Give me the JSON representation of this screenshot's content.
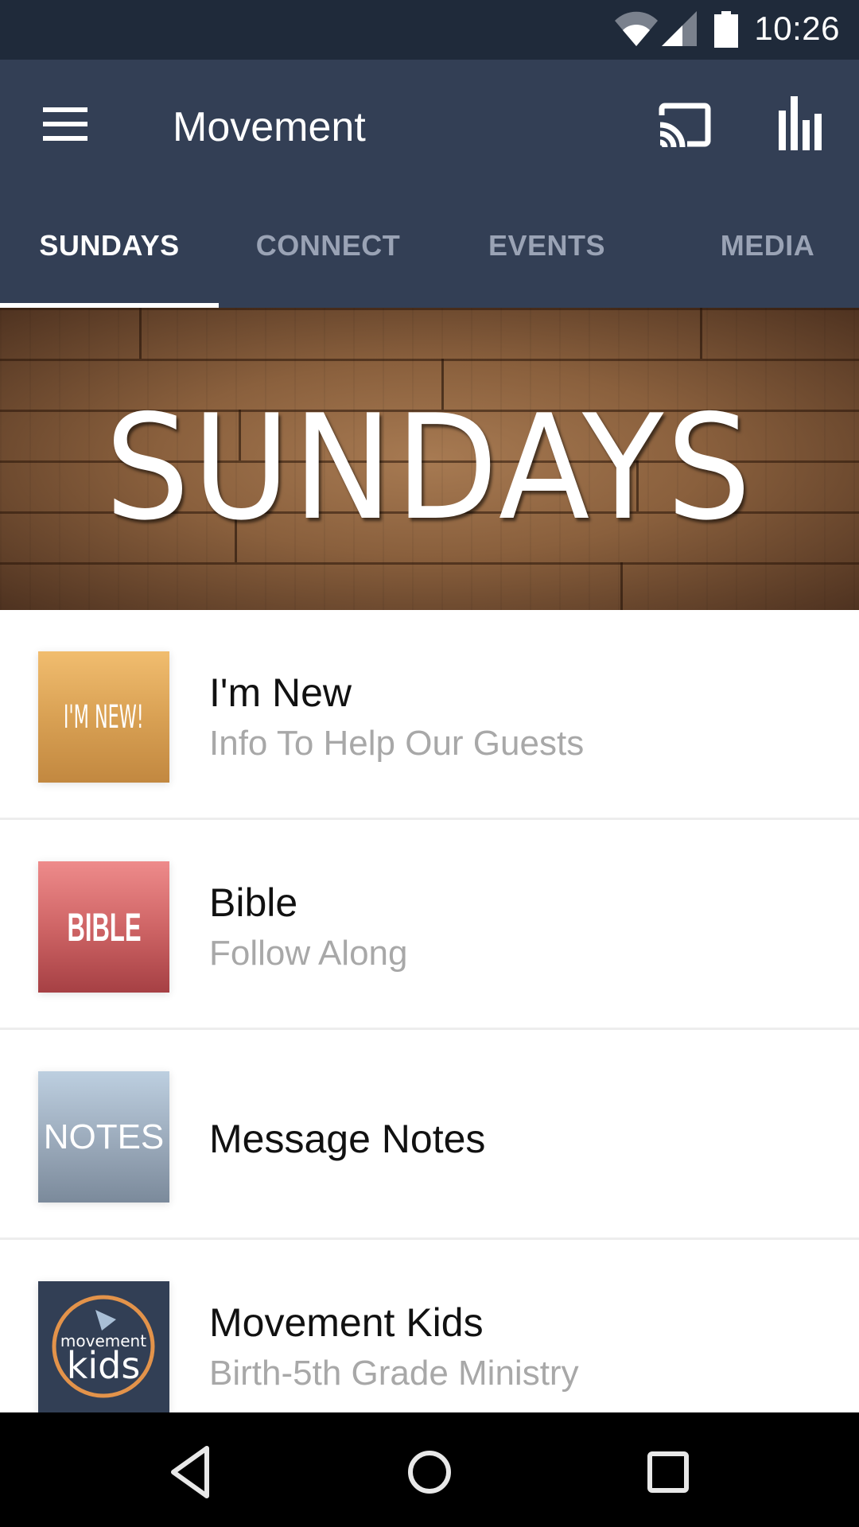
{
  "status_bar": {
    "time": "10:26",
    "icons": [
      "wifi-icon",
      "cellular-signal-icon",
      "battery-icon"
    ]
  },
  "app_bar": {
    "title": "Movement",
    "menu_icon": "hamburger-menu-icon",
    "actions": [
      {
        "name": "cast",
        "icon": "cast-icon"
      },
      {
        "name": "stats",
        "icon": "bar-chart-icon"
      }
    ],
    "background": "#333f55"
  },
  "tabs": [
    {
      "label": "SUNDAYS",
      "active": true
    },
    {
      "label": "CONNECT",
      "active": false
    },
    {
      "label": "EVENTS",
      "active": false
    },
    {
      "label": "MEDIA",
      "active": false
    }
  ],
  "banner": {
    "text": "SUNDAYS"
  },
  "list": [
    {
      "thumb_text": "I'M NEW!",
      "title": "I'm New",
      "subtitle": "Info To Help Our Guests",
      "thumb_color": "#d9a154"
    },
    {
      "thumb_text": "BIBLE",
      "title": "Bible",
      "subtitle": "Follow Along",
      "thumb_color": "#cf6566"
    },
    {
      "thumb_text": "NOTES",
      "title": "Message Notes",
      "subtitle": "",
      "thumb_color": "#9aa9ba"
    },
    {
      "thumb_text_top": "movement",
      "thumb_text_bottom": "kids",
      "title": "Movement Kids",
      "subtitle": "Birth-5th Grade Ministry",
      "thumb_color": "#323f55",
      "ring_color": "#e3934a"
    }
  ],
  "nav_bar": {
    "buttons": [
      "back-icon",
      "home-icon",
      "recents-icon"
    ]
  }
}
